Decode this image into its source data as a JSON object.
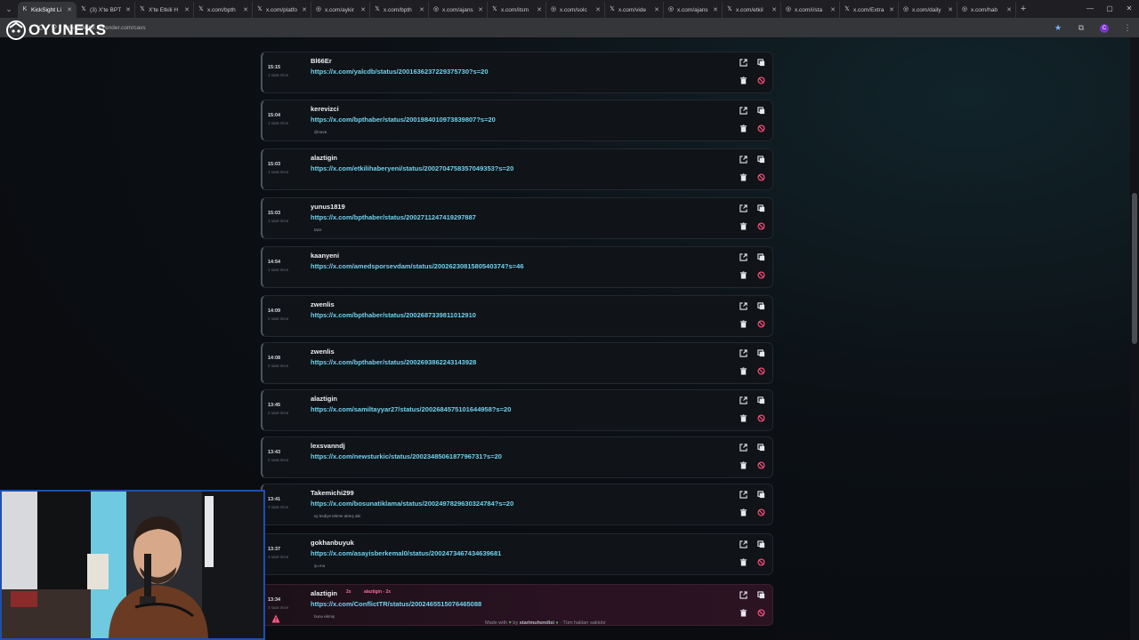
{
  "browser": {
    "tabs": [
      {
        "label": "KickSight Li",
        "icon": "k-icon",
        "active": true
      },
      {
        "label": "(3) X'te BPT",
        "icon": "x-icon"
      },
      {
        "label": "X'te Etkili H",
        "icon": "x-icon"
      },
      {
        "label": "x.com/bpth",
        "icon": "x-icon"
      },
      {
        "label": "x.com/platfo",
        "icon": "x-icon"
      },
      {
        "label": "x.com/aykir",
        "icon": "globe-icon"
      },
      {
        "label": "x.com/bpth",
        "icon": "x-icon"
      },
      {
        "label": "x.com/ajans",
        "icon": "globe-icon"
      },
      {
        "label": "x.com/itsm",
        "icon": "x-icon"
      },
      {
        "label": "x.com/solc",
        "icon": "globe-icon"
      },
      {
        "label": "x.com/vide",
        "icon": "x-icon"
      },
      {
        "label": "x.com/ajans",
        "icon": "globe-icon"
      },
      {
        "label": "x.com/etkil",
        "icon": "x-icon"
      },
      {
        "label": "x.com/i/sta",
        "icon": "globe-icon"
      },
      {
        "label": "x.com/Extra",
        "icon": "x-icon"
      },
      {
        "label": "x.com/daily",
        "icon": "globe-icon"
      },
      {
        "label": "x.com/hab",
        "icon": "globe-icon"
      }
    ],
    "url": "linkdetector.onrender.com/cavs",
    "profile_letter": "C"
  },
  "logo": {
    "text": "OYUNEKS"
  },
  "entries": [
    {
      "time": "15:15",
      "ago": "1 saat önce",
      "user": "Bl66Er",
      "link": "https://x.com/yalcdb/status/2001636237229375730?s=20",
      "note": ""
    },
    {
      "time": "15:04",
      "ago": "1 saat önce",
      "user": "kerevizci",
      "link": "https://x.com/bpthaber/status/2001984010973839807?s=20",
      "note": "@cava"
    },
    {
      "time": "15:03",
      "ago": "1 saat önce",
      "user": "alaztigin",
      "link": "https://x.com/etkilihaberyeni/status/2002704758357049353?s=20",
      "note": ""
    },
    {
      "time": "15:03",
      "ago": "1 saat önce",
      "user": "yunus1819",
      "link": "https://x.com/bpthaber/status/2002711247419297887",
      "note": "taze"
    },
    {
      "time": "14:54",
      "ago": "1 saat önce",
      "user": "kaanyeni",
      "link": "https://x.com/amedsporsevdam/status/2002623081580540374?s=46",
      "note": ""
    },
    {
      "time": "14:09",
      "ago": "2 saat önce",
      "user": "zwenlis",
      "link": "https://x.com/bpthaber/status/2002687339811012910",
      "note": ""
    },
    {
      "time": "14:08",
      "ago": "2 saat önce",
      "user": "zwenlis",
      "link": "https://x.com/bpthaber/status/2002693862243143928",
      "note": ""
    },
    {
      "time": "13:45",
      "ago": "2 saat önce",
      "user": "alaztigin",
      "link": "https://x.com/samiltayyar27/status/2002684575101644958?s=20",
      "note": ""
    },
    {
      "time": "13:43",
      "ago": "2 saat önce",
      "user": "lexsvanndj",
      "link": "https://x.com/newsturkic/status/2002348506187796731?s=20",
      "note": ""
    },
    {
      "time": "13:41",
      "ago": "3 saat önce",
      "user": "Takemichi299",
      "link": "https://x.com/bosunatiklama/status/2002497829630324784?s=20",
      "note": "üç kediye tekme atmış abi"
    },
    {
      "time": "13:37",
      "ago": "3 saat önce",
      "user": "gokhanbuyuk",
      "link": "https://x.com/asayisberkemal0/status/2002473467434639681",
      "note": "şu mu"
    },
    {
      "time": "13:34",
      "ago": "3 saat önce",
      "user": "alaztigin",
      "link": "https://x.com/ConflictTR/status/2002465515076465088",
      "note": "bunu ekmiş",
      "badge": "2x",
      "badge_detail": "alaztigin - 2x",
      "duplicate": true
    }
  ],
  "footer": {
    "prefix": "Made with",
    "by": "by",
    "author": "starimuhendisi",
    "suffix": "· Tüm hakları saklıdır"
  },
  "colors": {
    "link": "#6fd3f0",
    "danger": "#ff4f7e",
    "accent_border": "#4d5561",
    "duplicate_bg": "#2a1222"
  }
}
